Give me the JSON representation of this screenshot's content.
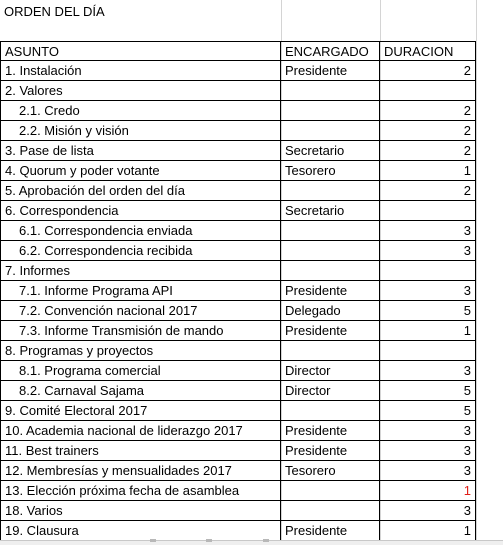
{
  "sheet": {
    "title": "ORDEN DEL DÍA",
    "headers": {
      "asunto": "ASUNTO",
      "encargado": "ENCARGADO",
      "duracion": "DURACION"
    },
    "rows": [
      {
        "asunto": "1. Instalación",
        "encargado": "Presidente",
        "duracion": "2",
        "indent": false,
        "highlight": false
      },
      {
        "asunto": "2. Valores",
        "encargado": "",
        "duracion": "",
        "indent": false,
        "highlight": false
      },
      {
        "asunto": "2.1. Credo",
        "encargado": "",
        "duracion": "2",
        "indent": true,
        "highlight": false
      },
      {
        "asunto": "2.2. Misión y visión",
        "encargado": "",
        "duracion": "2",
        "indent": true,
        "highlight": false
      },
      {
        "asunto": "3. Pase de lista",
        "encargado": "Secretario",
        "duracion": "2",
        "indent": false,
        "highlight": false
      },
      {
        "asunto": "4. Quorum y poder votante",
        "encargado": "Tesorero",
        "duracion": "1",
        "indent": false,
        "highlight": false
      },
      {
        "asunto": "5. Aprobación del orden del día",
        "encargado": "",
        "duracion": "2",
        "indent": false,
        "highlight": false
      },
      {
        "asunto": "6. Correspondencia",
        "encargado": "Secretario",
        "duracion": "",
        "indent": false,
        "highlight": false
      },
      {
        "asunto": "6.1. Correspondencia enviada",
        "encargado": "",
        "duracion": "3",
        "indent": true,
        "highlight": false
      },
      {
        "asunto": "6.2. Correspondencia recibida",
        "encargado": "",
        "duracion": "3",
        "indent": true,
        "highlight": false
      },
      {
        "asunto": "7. Informes",
        "encargado": "",
        "duracion": "",
        "indent": false,
        "highlight": false
      },
      {
        "asunto": "7.1. Informe Programa API",
        "encargado": "Presidente",
        "duracion": "3",
        "indent": true,
        "highlight": false
      },
      {
        "asunto": "7.2. Convención nacional 2017",
        "encargado": "Delegado",
        "duracion": "5",
        "indent": true,
        "highlight": false
      },
      {
        "asunto": "7.3. Informe Transmisión de mando",
        "encargado": "Presidente",
        "duracion": "1",
        "indent": true,
        "highlight": false
      },
      {
        "asunto": "8. Programas y proyectos",
        "encargado": "",
        "duracion": "",
        "indent": false,
        "highlight": false
      },
      {
        "asunto": "8.1. Programa comercial",
        "encargado": "Director",
        "duracion": "3",
        "indent": true,
        "highlight": false
      },
      {
        "asunto": "8.2. Carnaval Sajama",
        "encargado": "Director",
        "duracion": "5",
        "indent": true,
        "highlight": false
      },
      {
        "asunto": "9. Comité Electoral 2017",
        "encargado": "",
        "duracion": "5",
        "indent": false,
        "highlight": false
      },
      {
        "asunto": "10. Academia nacional de liderazgo 2017",
        "encargado": "Presidente",
        "duracion": "3",
        "indent": false,
        "highlight": false
      },
      {
        "asunto": "11. Best trainers",
        "encargado": "Presidente",
        "duracion": "3",
        "indent": false,
        "highlight": false
      },
      {
        "asunto": "12. Membresías y mensualidades 2017",
        "encargado": "Tesorero",
        "duracion": "3",
        "indent": false,
        "highlight": false
      },
      {
        "asunto": "13. Elección próxima fecha de asamblea",
        "encargado": "",
        "duracion": "1",
        "indent": false,
        "highlight": true
      },
      {
        "asunto": "18. Varios",
        "encargado": "",
        "duracion": "3",
        "indent": false,
        "highlight": false
      },
      {
        "asunto": "19. Clausura",
        "encargado": "Presidente",
        "duracion": "1",
        "indent": false,
        "highlight": false
      }
    ],
    "colors": {
      "highlight_text": "#e0201a",
      "border": "#000000",
      "gridline": "#d4d4d4"
    }
  }
}
